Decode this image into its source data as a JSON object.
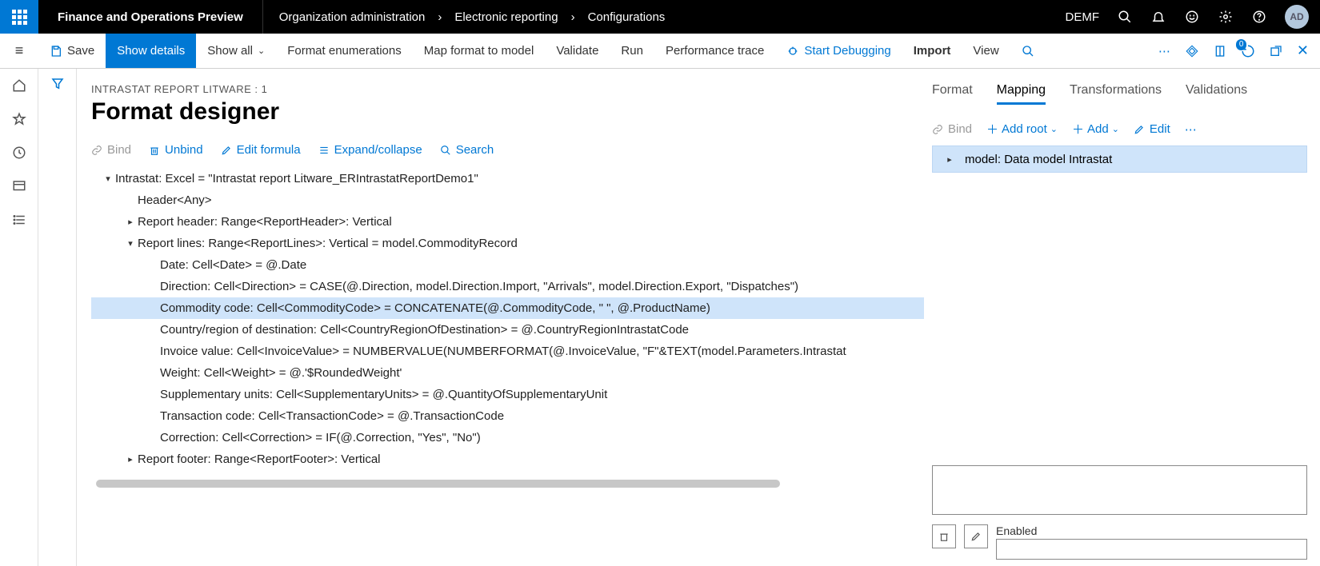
{
  "top": {
    "app_title": "Finance and Operations Preview",
    "breadcrumb": [
      "Organization administration",
      "Electronic reporting",
      "Configurations"
    ],
    "company": "DEMF",
    "avatar": "AD"
  },
  "ribbon": {
    "save": "Save",
    "show_details": "Show details",
    "show_all": "Show all",
    "format_enum": "Format enumerations",
    "map": "Map format to model",
    "validate": "Validate",
    "run": "Run",
    "perf": "Performance trace",
    "debug": "Start Debugging",
    "import": "Import",
    "view": "View",
    "badge": "0"
  },
  "page": {
    "crumb": "INTRASTAT REPORT LITWARE : 1",
    "title": "Format designer"
  },
  "tree_toolbar": {
    "bind": "Bind",
    "unbind": "Unbind",
    "edit_formula": "Edit formula",
    "expand": "Expand/collapse",
    "search": "Search"
  },
  "tree": [
    {
      "indent": 0,
      "caret": "▾",
      "text": "Intrastat: Excel = \"Intrastat report Litware_ERIntrastatReportDemo1\"",
      "sel": false
    },
    {
      "indent": 1,
      "caret": "",
      "text": "Header<Any>",
      "sel": false
    },
    {
      "indent": 1,
      "caret": "▸",
      "text": "Report header: Range<ReportHeader>: Vertical",
      "sel": false
    },
    {
      "indent": 1,
      "caret": "▾",
      "text": "Report lines: Range<ReportLines>: Vertical = model.CommodityRecord",
      "sel": false
    },
    {
      "indent": 2,
      "caret": "",
      "text": "Date: Cell<Date> = @.Date",
      "sel": false
    },
    {
      "indent": 2,
      "caret": "",
      "text": "Direction: Cell<Direction> = CASE(@.Direction, model.Direction.Import, \"Arrivals\", model.Direction.Export, \"Dispatches\")",
      "sel": false
    },
    {
      "indent": 2,
      "caret": "",
      "text": "Commodity code: Cell<CommodityCode> = CONCATENATE(@.CommodityCode, \" \", @.ProductName)",
      "sel": true
    },
    {
      "indent": 2,
      "caret": "",
      "text": "Country/region of destination: Cell<CountryRegionOfDestination> = @.CountryRegionIntrastatCode",
      "sel": false
    },
    {
      "indent": 2,
      "caret": "",
      "text": "Invoice value: Cell<InvoiceValue> = NUMBERVALUE(NUMBERFORMAT(@.InvoiceValue, \"F\"&TEXT(model.Parameters.Intrastat",
      "sel": false
    },
    {
      "indent": 2,
      "caret": "",
      "text": "Weight: Cell<Weight> = @.'$RoundedWeight'",
      "sel": false
    },
    {
      "indent": 2,
      "caret": "",
      "text": "Supplementary units: Cell<SupplementaryUnits> = @.QuantityOfSupplementaryUnit",
      "sel": false
    },
    {
      "indent": 2,
      "caret": "",
      "text": "Transaction code: Cell<TransactionCode> = @.TransactionCode",
      "sel": false
    },
    {
      "indent": 2,
      "caret": "",
      "text": "Correction: Cell<Correction> = IF(@.Correction, \"Yes\", \"No\")",
      "sel": false
    },
    {
      "indent": 1,
      "caret": "▸",
      "text": "Report footer: Range<ReportFooter>: Vertical",
      "sel": false
    }
  ],
  "right": {
    "tabs": {
      "format": "Format",
      "mapping": "Mapping",
      "transformations": "Transformations",
      "validations": "Validations"
    },
    "toolbar": {
      "bind": "Bind",
      "add_root": "Add root",
      "add": "Add",
      "edit": "Edit"
    },
    "model_row": "model: Data model Intrastat",
    "enabled_label": "Enabled"
  }
}
